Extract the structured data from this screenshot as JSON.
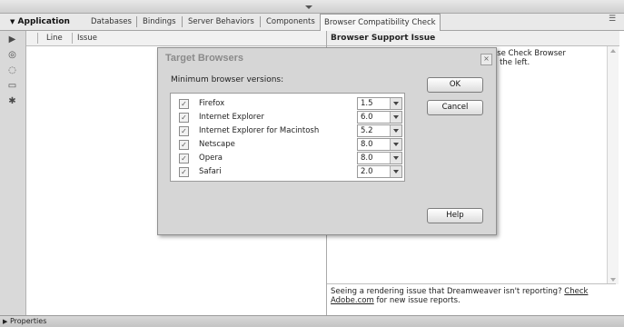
{
  "tabs": {
    "group": "Application",
    "items": [
      "Databases",
      "Bindings",
      "Server Behaviors",
      "Components",
      "Browser Compatibility Check"
    ]
  },
  "results": {
    "col_line": "Line",
    "col_issue": "Issue"
  },
  "issue_pane": {
    "title": "Browser Support Issue",
    "body_line1": "ose Check Browser",
    "body_line2": "n the left.",
    "footer_text": "Seeing a rendering issue that Dreamweaver isn't reporting?",
    "footer_link1": "Check",
    "footer_link2": "Adobe.com",
    "footer_tail": "for new issue reports."
  },
  "dialog": {
    "title": "Target Browsers",
    "label": "Minimum browser versions:",
    "browsers": [
      {
        "name": "Firefox",
        "version": "1.5",
        "checked": true
      },
      {
        "name": "Internet Explorer",
        "version": "6.0",
        "checked": true
      },
      {
        "name": "Internet Explorer for Macintosh",
        "version": "5.2",
        "checked": true
      },
      {
        "name": "Netscape",
        "version": "8.0",
        "checked": true
      },
      {
        "name": "Opera",
        "version": "8.0",
        "checked": true
      },
      {
        "name": "Safari",
        "version": "2.0",
        "checked": true
      }
    ],
    "ok_label": "OK",
    "cancel_label": "Cancel",
    "help_label": "Help"
  },
  "properties_bar": {
    "label": "Properties"
  },
  "icons": {
    "left_toolbar": [
      "play-icon",
      "circle-icon",
      "comment-icon",
      "page-icon",
      "gear-icon"
    ],
    "check_glyph": "✓"
  }
}
